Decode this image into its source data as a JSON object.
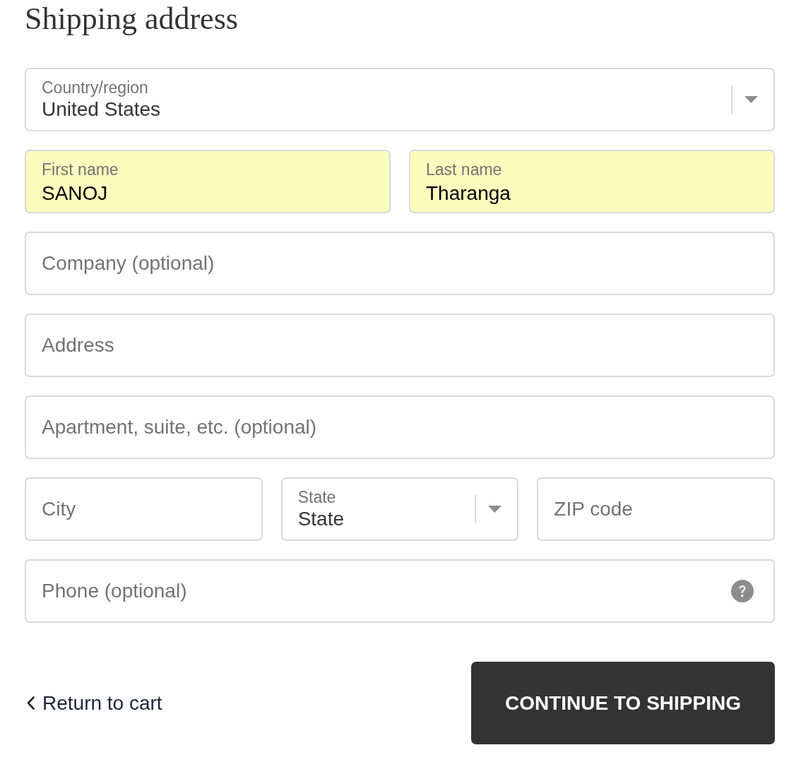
{
  "heading": "Shipping address",
  "rows": [
    {
      "fields": [
        {
          "kind": "select",
          "label": "Country/region",
          "value": "United States",
          "autofilled": false,
          "help": false
        }
      ]
    },
    {
      "fields": [
        {
          "kind": "text",
          "label": "First name",
          "value": "SANOJ",
          "autofilled": true,
          "help": false
        },
        {
          "kind": "text",
          "label": "Last name",
          "value": "Tharanga",
          "autofilled": true,
          "help": false
        }
      ]
    },
    {
      "fields": [
        {
          "kind": "text",
          "placeholder": "Company (optional)",
          "autofilled": false,
          "help": false
        }
      ]
    },
    {
      "fields": [
        {
          "kind": "text",
          "placeholder": "Address",
          "autofilled": false,
          "help": false
        }
      ]
    },
    {
      "fields": [
        {
          "kind": "text",
          "placeholder": "Apartment, suite, etc. (optional)",
          "autofilled": false,
          "help": false
        }
      ]
    },
    {
      "fields": [
        {
          "kind": "text",
          "placeholder": "City",
          "autofilled": false,
          "help": false
        },
        {
          "kind": "select",
          "label": "State",
          "value": "State",
          "autofilled": false,
          "help": false
        },
        {
          "kind": "text",
          "placeholder": "ZIP code",
          "autofilled": false,
          "help": false
        }
      ]
    },
    {
      "fields": [
        {
          "kind": "text",
          "placeholder": "Phone (optional)",
          "autofilled": false,
          "help": true
        }
      ]
    }
  ],
  "back_link": {
    "label": "Return to cart"
  },
  "submit_button": {
    "label": "CONTINUE TO SHIPPING"
  }
}
